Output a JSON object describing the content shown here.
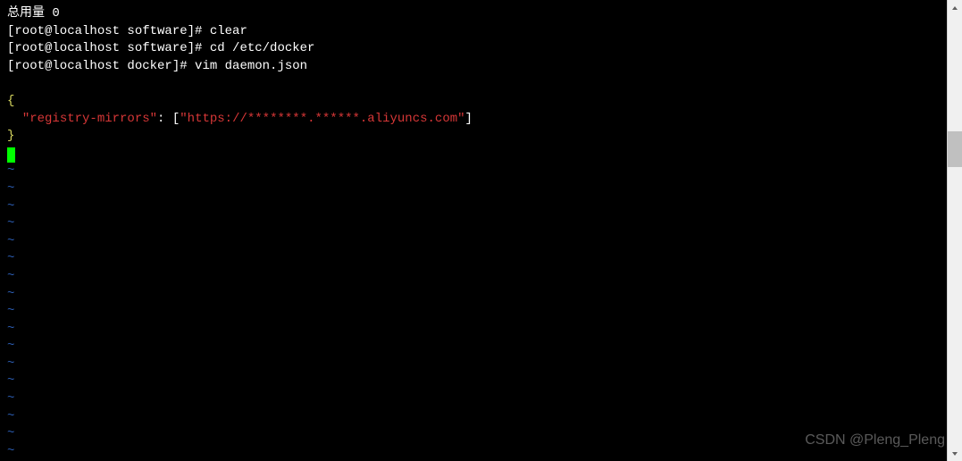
{
  "terminal": {
    "line1": "总用量 0",
    "prompt1": "[root@localhost software]# ",
    "cmd1": "clear",
    "prompt2": "[root@localhost software]# ",
    "cmd2": "cd /etc/docker",
    "prompt3": "[root@localhost docker]# ",
    "cmd3": "vim daemon.json",
    "json": {
      "brace_open": "{",
      "key_quoted": "\"registry-mirrors\"",
      "colon_space": ": [",
      "url_quoted": "\"https://********.******.aliyuncs.com\"",
      "close_bracket": "]",
      "brace_close": "}"
    },
    "tilde": "~"
  },
  "watermark": "CSDN @Pleng_Pleng"
}
